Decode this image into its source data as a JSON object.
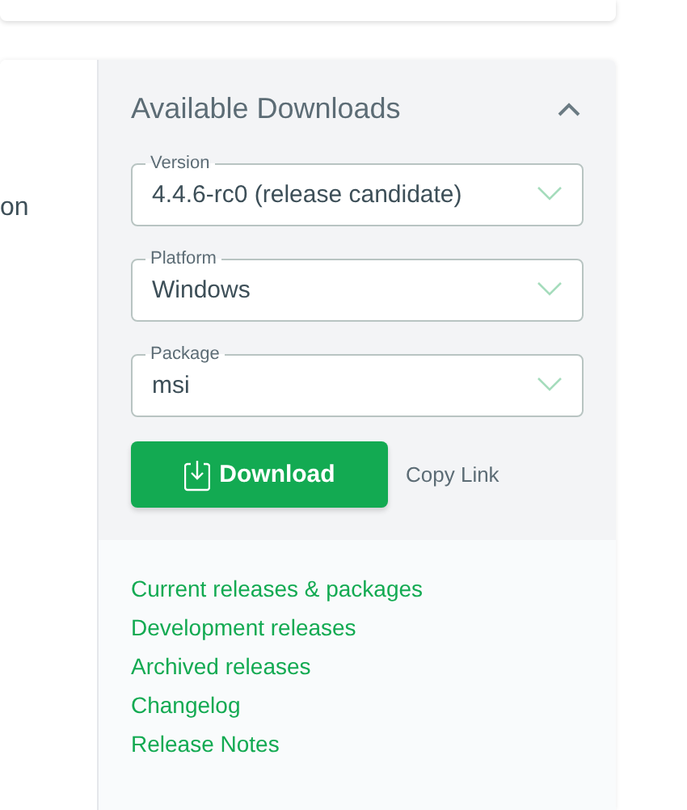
{
  "left_column": {
    "text_fragment": "on"
  },
  "downloads": {
    "title": "Available Downloads",
    "expanded": true,
    "fields": [
      {
        "label": "Version",
        "value": "4.4.6-rc0 (release candidate)"
      },
      {
        "label": "Platform",
        "value": "Windows"
      },
      {
        "label": "Package",
        "value": "msi"
      }
    ],
    "download_button": "Download",
    "copy_link": "Copy Link"
  },
  "links": [
    "Current releases & packages",
    "Development releases",
    "Archived releases",
    "Changelog",
    "Release Notes"
  ]
}
